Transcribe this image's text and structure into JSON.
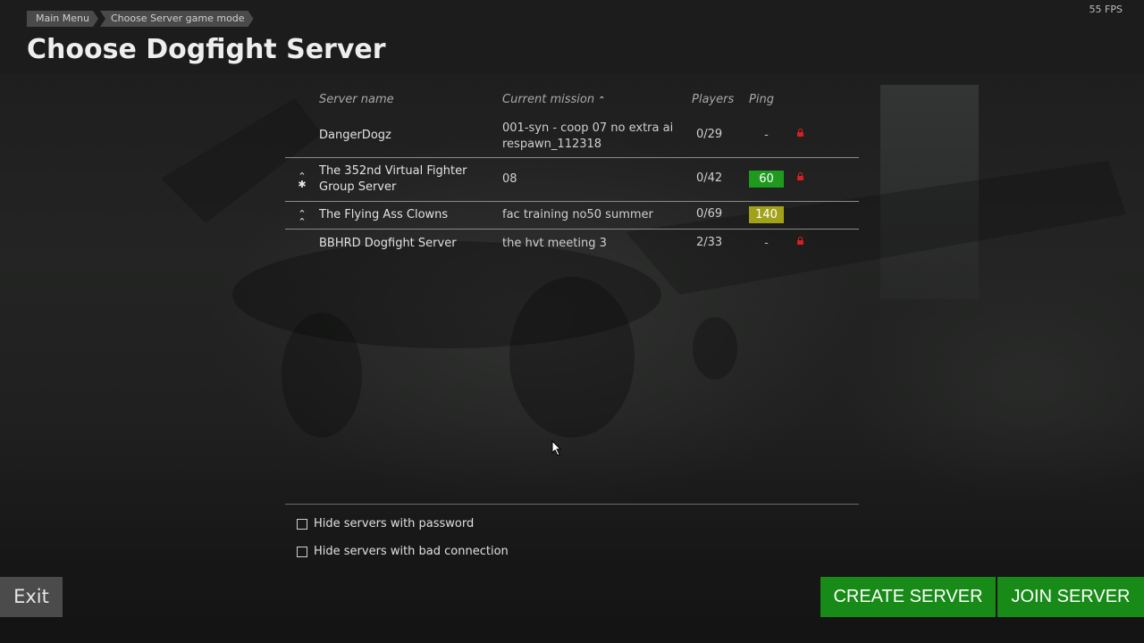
{
  "header": {
    "breadcrumb": [
      "Main Menu",
      "Choose Server game mode"
    ],
    "title": "Choose Dogfight Server",
    "fps": "55 FPS"
  },
  "table": {
    "columns": {
      "name": "Server name",
      "mission": "Current mission",
      "players": "Players",
      "ping": "Ping"
    },
    "sort_column": "Current mission",
    "sort_icon": "chevron-up-icon",
    "rows": [
      {
        "rank": "",
        "name": "DangerDogz",
        "mission": "001-syn - coop 07 no extra ai respawn_112318",
        "players": "0/29",
        "ping": "-",
        "ping_status": "none",
        "locked": true
      },
      {
        "rank": "star-chevron-icon",
        "name": "The 352nd Virtual Fighter Group Server",
        "mission": "08",
        "players": "0/42",
        "ping": "60",
        "ping_status": "good",
        "locked": true
      },
      {
        "rank": "double-chevron-icon",
        "name": "The Flying Ass Clowns",
        "mission": "fac training no50 summer",
        "players": "0/69",
        "ping": "140",
        "ping_status": "mid",
        "locked": false
      },
      {
        "rank": "",
        "name": "BBHRD Dogfight Server",
        "mission": "the hvt meeting 3",
        "players": "2/33",
        "ping": "-",
        "ping_status": "none",
        "locked": true
      }
    ]
  },
  "filters": {
    "hide_password": {
      "label": "Hide servers with password",
      "checked": false
    },
    "hide_bad_connection": {
      "label": "Hide servers with bad connection",
      "checked": false
    }
  },
  "buttons": {
    "exit": "Exit",
    "create": "CREATE SERVER",
    "join": "JOIN SERVER"
  },
  "colors": {
    "ping_good": "#1e9a1e",
    "ping_mid": "#a2a21a",
    "lock": "#d62020",
    "action_button": "#178a17"
  }
}
